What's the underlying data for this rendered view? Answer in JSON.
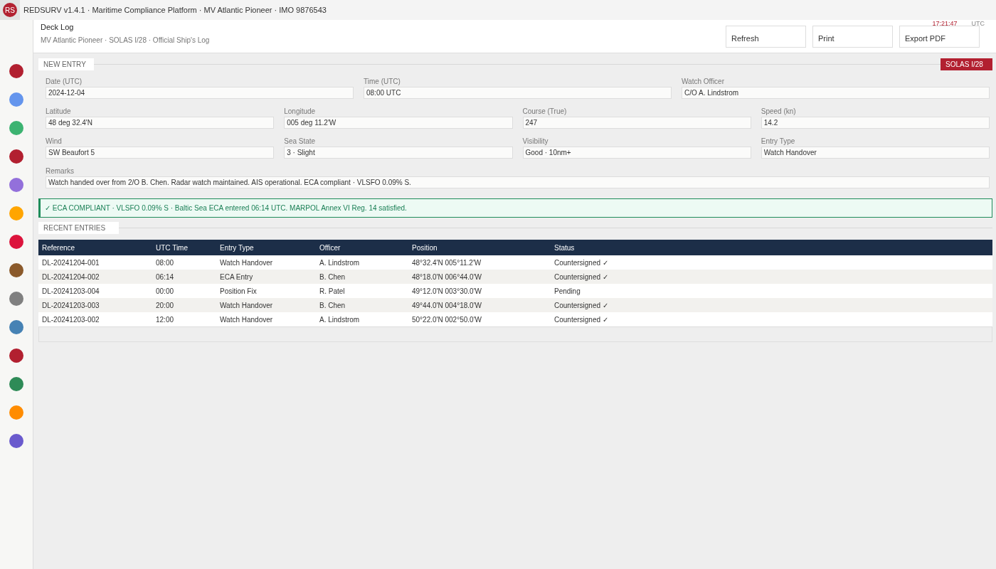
{
  "topbar": {
    "logo": "RS",
    "title": "REDSURV v1.4.1 · Maritime Compliance Platform · MV Atlantic Pioneer · IMO 9876543"
  },
  "sidebar": {
    "items": [
      {
        "color": "#b22030"
      },
      {
        "color": "#6495ed"
      },
      {
        "color": "#3cb371"
      },
      {
        "color": "#b22030"
      },
      {
        "color": "#9370db"
      },
      {
        "color": "#ffa500"
      },
      {
        "color": "#dc143c"
      },
      {
        "color": "#8b5a2b"
      },
      {
        "color": "#808080"
      },
      {
        "color": "#4682b4"
      },
      {
        "color": "#b22030"
      },
      {
        "color": "#2e8b57"
      },
      {
        "color": "#ff8c00"
      },
      {
        "color": "#6a5acd"
      }
    ]
  },
  "header": {
    "title": "Deck Log",
    "subtitle": "MV Atlantic Pioneer · SOLAS I/28 · Official Ship's Log",
    "clock": "17:21:47",
    "clock_zone": "UTC",
    "buttons": [
      "Refresh",
      "Print",
      "Export PDF"
    ]
  },
  "new_entry": {
    "title": "NEW ENTRY",
    "badge": "SOLAS I/28",
    "rows": [
      [
        {
          "label": "Date (UTC)",
          "value": "2024-12-04"
        },
        {
          "label": "Time (UTC)",
          "value": "08:00 UTC"
        },
        {
          "label": "Watch Officer",
          "value": "C/O A. Lindstrom"
        }
      ],
      [
        {
          "label": "Latitude",
          "value": "48 deg 32.4'N"
        },
        {
          "label": "Longitude",
          "value": "005 deg 11.2'W"
        },
        {
          "label": "Course (True)",
          "value": "247"
        },
        {
          "label": "Speed (kn)",
          "value": "14.2"
        }
      ],
      [
        {
          "label": "Wind",
          "value": "SW Beaufort 5"
        },
        {
          "label": "Sea State",
          "value": "3 · Slight"
        },
        {
          "label": "Visibility",
          "value": "Good · 10nm+"
        },
        {
          "label": "Entry Type",
          "value": "Watch Handover"
        }
      ],
      [
        {
          "label": "Remarks",
          "value": "Watch handed over from 2/O B. Chen. Radar watch maintained. AIS operational. ECA compliant · VLSFO 0.09% S."
        }
      ]
    ]
  },
  "alert": {
    "text": "✓ ECA COMPLIANT · VLSFO 0.09% S · Baltic Sea ECA entered 06:14 UTC. MARPOL Annex VI Reg. 14 satisfied."
  },
  "recent": {
    "title": "RECENT ENTRIES",
    "columns": [
      "Reference",
      "UTC Time",
      "Entry Type",
      "Officer",
      "Position",
      "Status"
    ],
    "rows": [
      [
        "DL-20241204-001",
        "08:00",
        "Watch Handover",
        "A. Lindstrom",
        "48°32.4'N 005°11.2'W",
        "Countersigned ✓"
      ],
      [
        "DL-20241204-002",
        "06:14",
        "ECA Entry",
        "B. Chen",
        "48°18.0'N 006°44.0'W",
        "Countersigned ✓"
      ],
      [
        "DL-20241203-004",
        "00:00",
        "Position Fix",
        "R. Patel",
        "49°12.0'N 003°30.0'W",
        "Pending"
      ],
      [
        "DL-20241203-003",
        "20:00",
        "Watch Handover",
        "B. Chen",
        "49°44.0'N 004°18.0'W",
        "Countersigned ✓"
      ],
      [
        "DL-20241203-002",
        "12:00",
        "Watch Handover",
        "A. Lindstrom",
        "50°22.0'N 002°50.0'W",
        "Countersigned ✓"
      ]
    ]
  }
}
